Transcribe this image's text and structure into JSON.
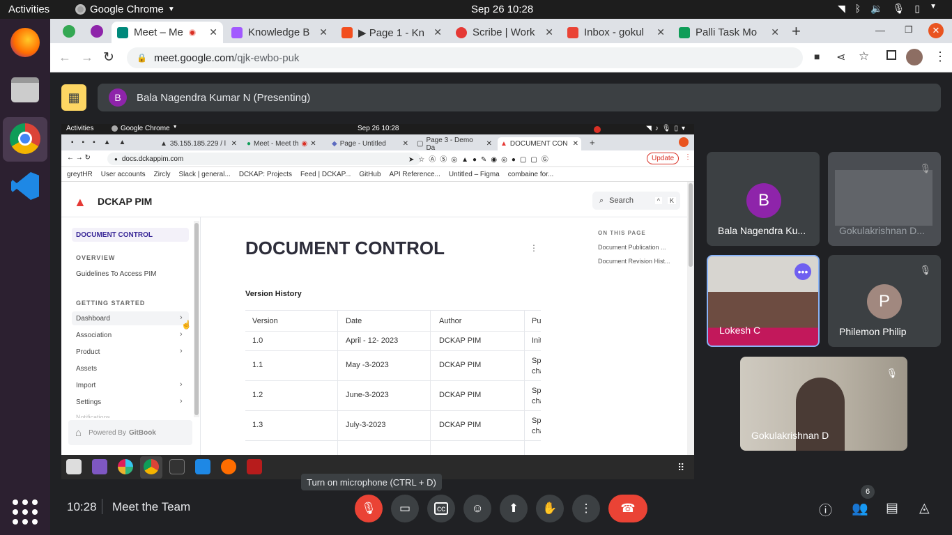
{
  "os": {
    "activities": "Activities",
    "app_name": "Google Chrome",
    "clock": "Sep 26  10:28"
  },
  "browser": {
    "tabs": [
      {
        "label": "Meet – Me",
        "icon": "meet-icon",
        "color": "#00897b"
      },
      {
        "label": "Knowledge B",
        "icon": "figma-icon",
        "color": "#a259ff"
      },
      {
        "label": "▶ Page 1 - Kn",
        "icon": "figma-icon",
        "color": "#f24e1e"
      },
      {
        "label": "Scribe | Work",
        "icon": "scribe-icon",
        "color": "#e53935"
      },
      {
        "label": "Inbox - gokul",
        "icon": "gmail-icon",
        "color": "#ea4335"
      },
      {
        "label": "Palli Task Mo",
        "icon": "sheets-icon",
        "color": "#0f9d58"
      }
    ],
    "url_host": "meet.google.com",
    "url_path": "/qjk-ewbo-puk"
  },
  "meet": {
    "presenter_name": "Bala Nagendra Kumar N (Presenting)",
    "presenter_initial": "B",
    "meeting_time": "10:28",
    "meeting_title": "Meet the Team",
    "tooltip": "Turn on microphone (CTRL + D)",
    "participant_count": "6",
    "participants": [
      {
        "name": "Bala Nagendra Ku...",
        "initial": "B",
        "color": "#8e24aa"
      },
      {
        "name": "Gokulakrishnan D..."
      },
      {
        "name": "Lokesh C"
      },
      {
        "name": "Philemon Philip",
        "initial": "P",
        "color": "#a1887f"
      },
      {
        "name": "Gokulakrishnan D"
      }
    ]
  },
  "shared": {
    "os_activities": "Activities",
    "os_app": "Google Chrome",
    "os_clock": "Sep 26  10:28",
    "tabs": [
      "35.155.185.229 / l",
      "Meet - Meet th",
      "Page - Untitled",
      "Page 3 - Demo Da",
      "DOCUMENT CON"
    ],
    "url": "docs.dckappim.com",
    "update_label": "Update",
    "bookmarks": [
      "greytHR",
      "User accounts",
      "Zircly",
      "Slack | general...",
      "DCKAP: Projects",
      "Feed | DCKAP...",
      "GitHub",
      "API Reference...",
      "Untitled – Figma",
      "combaine for..."
    ],
    "brand": "DCKAP PIM",
    "search_label": "Search",
    "search_keys": [
      "^",
      "K"
    ],
    "nav_active": "DOCUMENT CONTROL",
    "nav_overview": "OVERVIEW",
    "nav_guidelines": "Guidelines To Access PIM",
    "nav_getting_started": "GETTING STARTED",
    "nav_items": [
      "Dashboard",
      "Association",
      "Product",
      "Assets",
      "Import",
      "Settings",
      "Notifications"
    ],
    "powered_by": "Powered By",
    "gitbook": "GitBook",
    "page_title": "DOCUMENT CONTROL",
    "section": "Version History",
    "on_this_page": "ON THIS PAGE",
    "toc": [
      "Document Publication ...",
      "Document Revision Hist..."
    ],
    "table_headers": [
      "Version",
      "Date",
      "Author",
      "Pu"
    ],
    "table_rows": [
      {
        "version": "1.0",
        "date": "April - 12- 2023",
        "author": "DCKAP PIM",
        "pu": "Init"
      },
      {
        "version": "1.1",
        "date": "May -3-2023",
        "author": "DCKAP PIM",
        "pu": "Sp cha"
      },
      {
        "version": "1.2",
        "date": "June-3-2023",
        "author": "DCKAP PIM",
        "pu": "Sp cha"
      },
      {
        "version": "1.3",
        "date": "July-3-2023",
        "author": "DCKAP PIM",
        "pu": "Sp cha"
      }
    ]
  }
}
